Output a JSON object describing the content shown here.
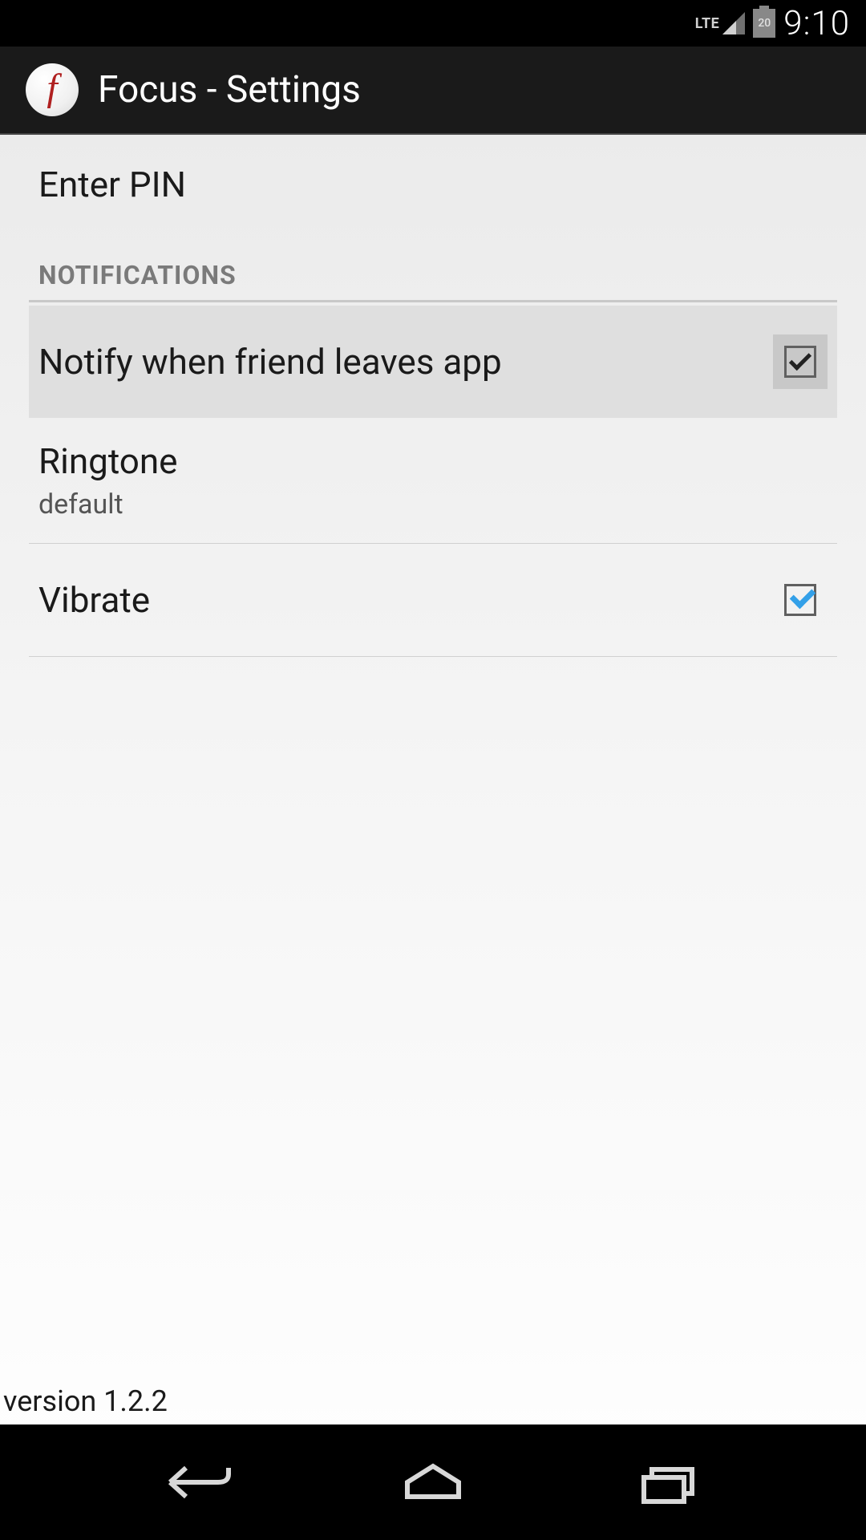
{
  "status_bar": {
    "network": "LTE",
    "battery": "20",
    "time": "9:10"
  },
  "action_bar": {
    "title": "Focus - Settings",
    "icon_letter": "f"
  },
  "settings": {
    "enter_pin_label": "Enter PIN",
    "notifications_header": "NOTIFICATIONS",
    "notify_friend_label": "Notify when friend leaves app",
    "notify_friend_checked": true,
    "ringtone_label": "Ringtone",
    "ringtone_value": "default",
    "vibrate_label": "Vibrate",
    "vibrate_checked": true
  },
  "footer": {
    "version": "version 1.2.2"
  }
}
